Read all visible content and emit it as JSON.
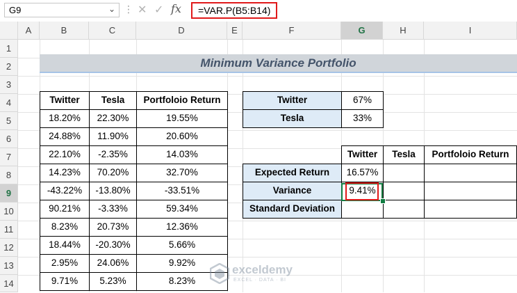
{
  "formula_bar": {
    "name_box": "G9",
    "fx": "fx",
    "formula": "=VAR.P(B5:B14)"
  },
  "columns": [
    "A",
    "B",
    "C",
    "D",
    "E",
    "F",
    "G",
    "H",
    "I"
  ],
  "active_column": "G",
  "rows": [
    "1",
    "2",
    "3",
    "4",
    "5",
    "6",
    "7",
    "8",
    "9",
    "10",
    "11",
    "12",
    "13",
    "14"
  ],
  "active_row": "9",
  "title": "Minimum Variance Portfolio",
  "returns_table": {
    "headers": [
      "Twitter",
      "Tesla",
      "Portfoloio Return"
    ],
    "rows": [
      [
        "18.20%",
        "22.30%",
        "19.55%"
      ],
      [
        "24.88%",
        "11.90%",
        "20.60%"
      ],
      [
        "22.10%",
        "-2.35%",
        "14.03%"
      ],
      [
        "14.23%",
        "70.20%",
        "32.70%"
      ],
      [
        "-43.22%",
        "-13.80%",
        "-33.51%"
      ],
      [
        "90.21%",
        "-3.33%",
        "59.34%"
      ],
      [
        "8.23%",
        "20.73%",
        "12.36%"
      ],
      [
        "18.44%",
        "-20.30%",
        "5.66%"
      ],
      [
        "2.95%",
        "24.06%",
        "9.92%"
      ],
      [
        "9.71%",
        "5.23%",
        "8.23%"
      ]
    ]
  },
  "weights_table": {
    "rows": [
      {
        "label": "Twitter",
        "value": "67%"
      },
      {
        "label": "Tesla",
        "value": "33%"
      }
    ]
  },
  "stats_table": {
    "headers": [
      "Twitter",
      "Tesla",
      "Portfoloio Return"
    ],
    "rows": [
      {
        "label": "Expected Return",
        "values": [
          "16.57%",
          "",
          ""
        ]
      },
      {
        "label": "Variance",
        "values": [
          "9.41%",
          "",
          ""
        ]
      },
      {
        "label": "Standard Deviation",
        "values": [
          "",
          "",
          ""
        ]
      }
    ]
  },
  "watermark": {
    "name": "exceldemy",
    "tagline": "EXCEL · DATA · BI"
  }
}
